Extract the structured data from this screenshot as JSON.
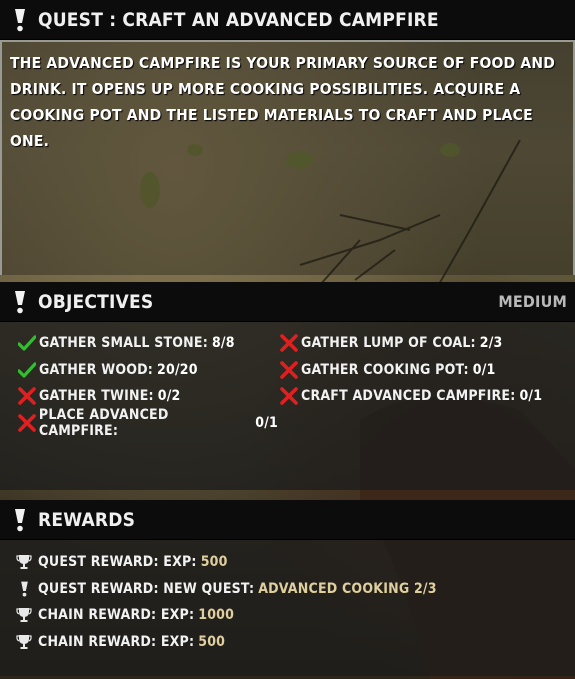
{
  "quest_header": {
    "title": "QUEST : CRAFT AN ADVANCED CAMPFIRE",
    "icon": "exclamation-icon"
  },
  "description": "THE ADVANCED CAMPFIRE IS YOUR PRIMARY SOURCE OF FOOD AND DRINK. IT OPENS UP MORE COOKING POSSIBILITIES. ACQUIRE A COOKING POT AND THE LISTED MATERIALS TO CRAFT AND PLACE ONE.",
  "objectives": {
    "title": "OBJECTIVES",
    "difficulty": "MEDIUM",
    "items": [
      {
        "label": "GATHER SMALL STONE:",
        "value": "8/8",
        "status": "complete"
      },
      {
        "label": "GATHER LUMP OF COAL:",
        "value": "2/3",
        "status": "incomplete"
      },
      {
        "label": "GATHER WOOD:",
        "value": "20/20",
        "status": "complete"
      },
      {
        "label": "GATHER COOKING POT:",
        "value": "0/1",
        "status": "incomplete"
      },
      {
        "label": "GATHER TWINE:",
        "value": "0/2",
        "status": "incomplete"
      },
      {
        "label": "CRAFT ADVANCED CAMPFIRE:",
        "value": "0/1",
        "status": "incomplete"
      },
      {
        "label": "PLACE ADVANCED CAMPFIRE:",
        "value": "0/1",
        "status": "incomplete"
      }
    ]
  },
  "rewards": {
    "title": "REWARDS",
    "items": [
      {
        "label": "QUEST REWARD: EXP:",
        "value": "500",
        "icon": "trophy-icon"
      },
      {
        "label": "QUEST REWARD: NEW QUEST:",
        "value": "ADVANCED COOKING 2/3",
        "icon": "exclamation-icon"
      },
      {
        "label": "CHAIN REWARD: EXP:",
        "value": "1000",
        "icon": "trophy-icon"
      },
      {
        "label": "CHAIN REWARD: EXP:",
        "value": "500",
        "icon": "trophy-icon"
      }
    ]
  },
  "colors": {
    "complete": "#2fbf2f",
    "incomplete": "#e02020",
    "reward_value": "#e0cf9e"
  }
}
